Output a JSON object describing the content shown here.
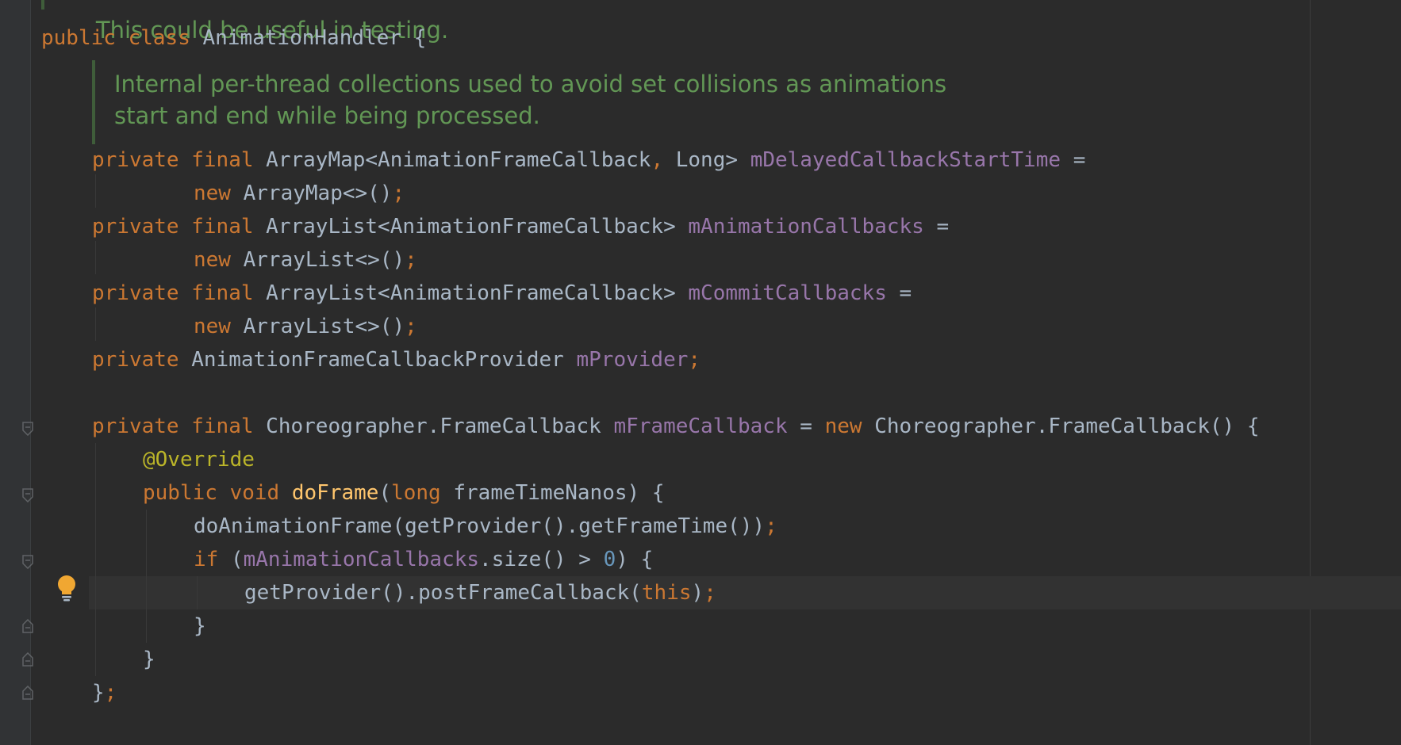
{
  "doc_comments": {
    "class_doc_tail": "This could be useful in testing.",
    "field_doc_line1": "Internal per-thread collections used to avoid set collisions as animations",
    "field_doc_line2": "start and end while being processed."
  },
  "code": {
    "class_decl": {
      "kw1": "public",
      "kw2": "class",
      "name": "AnimationHandler",
      "brace": "{"
    },
    "field1": {
      "kw1": "private",
      "kw2": "final",
      "type_a": "ArrayMap<AnimationFrameCallback",
      "comma": ",",
      "type_b": "Long>",
      "name": "mDelayedCallbackStartTime",
      "eq": "=",
      "new_kw": "new",
      "ctor": "ArrayMap<>()",
      "semi": ";"
    },
    "field2": {
      "kw1": "private",
      "kw2": "final",
      "type": "ArrayList<AnimationFrameCallback>",
      "name": "mAnimationCallbacks",
      "eq": "=",
      "new_kw": "new",
      "ctor": "ArrayList<>()",
      "semi": ";"
    },
    "field3": {
      "kw1": "private",
      "kw2": "final",
      "type": "ArrayList<AnimationFrameCallback>",
      "name": "mCommitCallbacks",
      "eq": "=",
      "new_kw": "new",
      "ctor": "ArrayList<>()",
      "semi": ";"
    },
    "field4": {
      "kw1": "private",
      "type": "AnimationFrameCallbackProvider",
      "name": "mProvider",
      "semi": ";"
    },
    "frame_callback": {
      "kw1": "private",
      "kw2": "final",
      "type": "Choreographer.FrameCallback",
      "name": "mFrameCallback",
      "eq": "=",
      "new_kw": "new",
      "ctor": "Choreographer.FrameCallback()",
      "brace": "{"
    },
    "annotation": "@Override",
    "method_decl": {
      "kw1": "public",
      "kw2": "void",
      "name": "doFrame",
      "open": "(",
      "param_type": "long",
      "param_name": "frameTimeNanos",
      "close": ")",
      "brace": "{"
    },
    "stmt1": {
      "call": "doAnimationFrame(getProvider().getFrameTime())",
      "semi": ";"
    },
    "if_stmt": {
      "kw": "if",
      "open": "(",
      "field": "mAnimationCallbacks",
      "rest": ".size() >",
      "num": "0",
      "close": ")",
      "brace": "{"
    },
    "stmt2": {
      "call": "getProvider().postFrameCallback(",
      "this_kw": "this",
      "close": ")",
      "semi": ";"
    },
    "close_if": "}",
    "close_method": "}",
    "close_class": {
      "brace": "}",
      "semi": ";"
    }
  },
  "colors": {
    "background": "#2b2b2b",
    "keyword": "#cc7832",
    "field": "#9876aa",
    "method": "#ffc66d",
    "annotation": "#bbb529",
    "number": "#6897bb",
    "doc_comment": "#629755",
    "text": "#a9b7c6"
  },
  "icons": {
    "intention": "lightbulb-icon",
    "fold": "fold-marker-icon"
  }
}
